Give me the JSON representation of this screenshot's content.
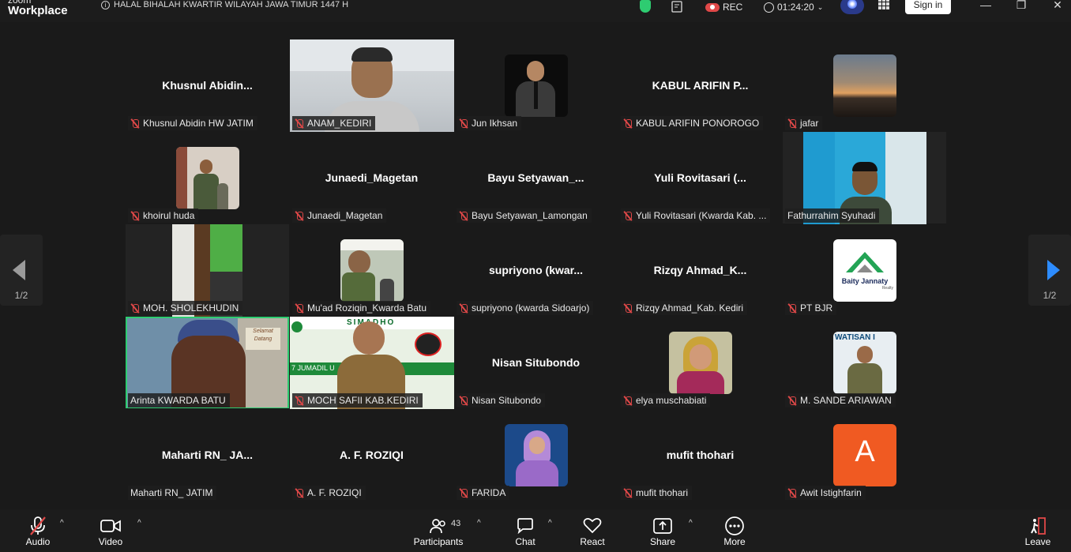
{
  "app": {
    "logo_top": "zoom",
    "logo_name": "Workplace"
  },
  "meeting": {
    "title": "HALAL BIHALAH KWARTIR WILAYAH JAWA TIMUR 1447 H",
    "rec_label": "REC",
    "timer": "01:24:20",
    "signin_label": "Sign in"
  },
  "pager": {
    "left_page": "1/2",
    "right_page": "1/2"
  },
  "participants": [
    {
      "big": "Khusnul  Abidin...",
      "label": "Khusnul Abidin HW JATIM",
      "muted": true
    },
    {
      "big": "",
      "label": "ANAM_KEDIRI",
      "muted": true
    },
    {
      "big": "",
      "label": "Jun Ikhsan",
      "muted": true
    },
    {
      "big": "KABUL ARIFIN P...",
      "label": "KABUL ARIFIN PONOROGO",
      "muted": true
    },
    {
      "big": "",
      "label": "jafar",
      "muted": true
    },
    {
      "big": "",
      "label": "khoirul huda",
      "muted": true
    },
    {
      "big": "Junaedi_Magetan",
      "label": "Junaedi_Magetan",
      "muted": true
    },
    {
      "big": "Bayu  Setyawan_...",
      "label": "Bayu Setyawan_Lamongan",
      "muted": true
    },
    {
      "big": "Yuli  Rovitasari  (...",
      "label": "Yuli Rovitasari (Kwarda Kab. ...",
      "muted": true
    },
    {
      "big": "",
      "label": "Fathurrahim Syuhadi",
      "muted": false
    },
    {
      "big": "",
      "label": "MOH. SHOLEKHUDIN",
      "muted": true
    },
    {
      "big": "",
      "label": "Mu'ad Roziqin_Kwarda Batu",
      "muted": true
    },
    {
      "big": "supriyono  (kwar...",
      "label": "supriyono (kwarda Sidoarjo)",
      "muted": true
    },
    {
      "big": "Rizqy  Ahmad_K...",
      "label": "Rizqy Ahmad_Kab. Kediri",
      "muted": true
    },
    {
      "big": "",
      "label": "PT BJR",
      "muted": true
    },
    {
      "big": "",
      "label": "Arinta KWARDA BATU",
      "muted": false
    },
    {
      "big": "",
      "label": "MOCH SAFII KAB.KEDIRI",
      "muted": true
    },
    {
      "big": "Nisan Situbondo",
      "label": "Nisan Situbondo",
      "muted": true
    },
    {
      "big": "",
      "label": "elya muschabiati",
      "muted": true
    },
    {
      "big": "",
      "label": "M. SANDE ARIAWAN",
      "muted": true
    },
    {
      "big": "Maharti RN_  JA...",
      "label": "Maharti RN_ JATIM",
      "muted": false
    },
    {
      "big": "A. F. ROZIQI",
      "label": "A. F. ROZIQI",
      "muted": true
    },
    {
      "big": "",
      "label": "FARIDA",
      "muted": true
    },
    {
      "big": "mufit thohari",
      "label": "mufit thohari",
      "muted": true
    },
    {
      "big": "",
      "label": "Awit Istighfarin",
      "muted": true
    }
  ],
  "tiles_text": {
    "bjr_logo": "Baity Jannaty",
    "bjr_sub": "Realty",
    "awit_initial": "A",
    "safii_banner": "SIMADHO",
    "safii_sub": "7 JUMADIL U",
    "arinta_sign": "Selamat Datang",
    "sande_banner": "WATISAN I"
  },
  "toolbar": {
    "audio": "Audio",
    "video": "Video",
    "participants": "Participants",
    "participants_count": "43",
    "chat": "Chat",
    "react": "React",
    "share": "Share",
    "more": "More",
    "leave": "Leave"
  },
  "colors": {
    "active_speaker": "#2ecc71",
    "mute_red": "#e04848",
    "share_green": "#23a455",
    "awit_avatar": "#f05a22"
  }
}
